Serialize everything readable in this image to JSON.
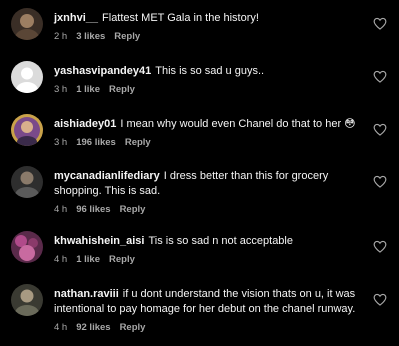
{
  "comments": [
    {
      "username": "jxnhvi__",
      "text": "Flattest MET Gala in the history!",
      "time": "2 h",
      "likes": "3 likes",
      "reply": "Reply",
      "avatar_color": "#6b5a4a"
    },
    {
      "username": "yashasvipandey41",
      "text": "This is so sad u guys..",
      "time": "3 h",
      "likes": "1 like",
      "reply": "Reply",
      "avatar_color": "#c8c8c8"
    },
    {
      "username": "aishiadey01",
      "text": "I mean why would even Chanel do that to her 😳",
      "time": "3 h",
      "likes": "196 likes",
      "reply": "Reply",
      "avatar_color": "#8a5a9a"
    },
    {
      "username": "mycanadianlifediary",
      "text": "I dress better than this for grocery shopping. This is sad.",
      "time": "4 h",
      "likes": "96 likes",
      "reply": "Reply",
      "avatar_color": "#4a4a4a"
    },
    {
      "username": "khwahishein_aisi",
      "text": "Tis is so sad n not acceptable",
      "time": "4 h",
      "likes": "1 like",
      "reply": "Reply",
      "avatar_color": "#7a3e6a"
    },
    {
      "username": "nathan.raviii",
      "text": "if u dont understand the vision thats on u, it was intentional to pay homage for her debut on the chanel runway.",
      "time": "4 h",
      "likes": "92 likes",
      "reply": "Reply",
      "avatar_color": "#6a6a5a"
    }
  ],
  "colors": {
    "background": "#000000",
    "text": "#f5f5f5",
    "meta": "#a8a8a8",
    "heart": "#a8a8a8"
  },
  "icons": {
    "like": "heart-outline-icon"
  }
}
